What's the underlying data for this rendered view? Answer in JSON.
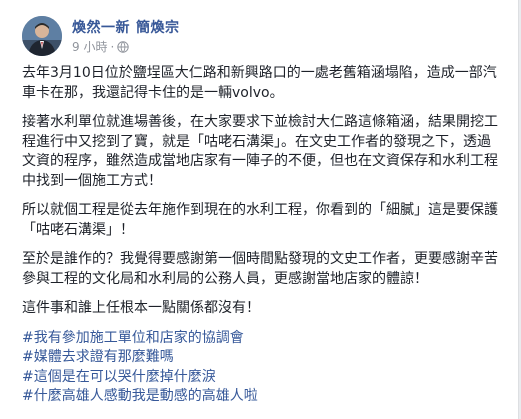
{
  "post": {
    "author_page": "煥然一新",
    "author_name": "簡煥宗",
    "timestamp": "9 小時",
    "separator": "·",
    "privacy_icon": "globe-icon",
    "paragraphs": [
      "去年3月10日位於鹽埕區大仁路和新興路口的一處老舊箱涵塌陷，造成一部汽車卡在那，我還記得卡住的是一輛volvo。",
      "接著水利單位就進場善後，在大家要求下並檢討大仁路這條箱涵，結果開挖工程進行中又挖到了寶，就是「咕咾石溝渠」。在文史工作者的發現之下，透過文資的程序，雖然造成當地店家有一陣子的不便，但也在文資保存和水利工程中找到一個施工方式！",
      "所以就個工程是從去年施作到現在的水利工程，你看到的「細膩」這是要保護「咕咾石溝渠」！",
      "至於是誰作的？我覺得要感謝第一個時間點發現的文史工作者，更要感謝辛苦參與工程的文化局和水利局的公務人員，更感謝當地店家的體諒！",
      "這件事和誰上任根本一點關係都沒有！"
    ],
    "hashtags": [
      "#我有參加施工單位和店家的協調會",
      "#媒體去求證有那麼難嗎",
      "#這個是在可以哭什麼掉什麼淚",
      "#什麼高雄人感動我是動感的高雄人啦"
    ]
  },
  "colors": {
    "link": "#385898",
    "text": "#1d2129",
    "meta": "#90949c"
  }
}
